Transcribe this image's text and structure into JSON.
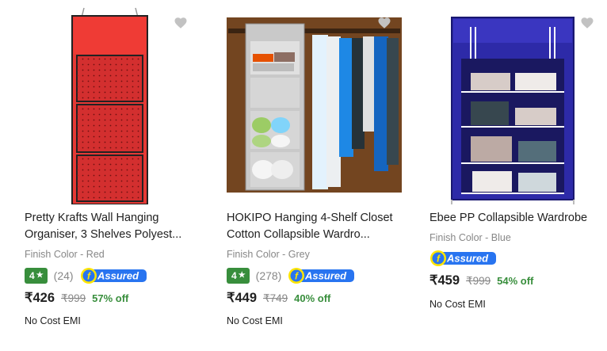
{
  "colors": {
    "accent_green": "#388e3c",
    "assured_blue": "#2874f0",
    "assured_yellow": "#ffe500",
    "muted": "#878787"
  },
  "products": [
    {
      "title_line1": "Pretty Krafts Wall Hanging",
      "title_line2": "Organiser, 3 Shelves Polyest...",
      "finish_color": "Finish Color - Red",
      "rating": "4",
      "rating_count": "(24)",
      "assured_label": "Assured",
      "price": "₹426",
      "mrp": "₹999",
      "discount": "57% off",
      "emi": "No Cost EMI",
      "wishlist_icon": "heart-icon"
    },
    {
      "title_line1": "HOKIPO Hanging 4-Shelf Closet",
      "title_line2": "Cotton Collapsible Wardro...",
      "finish_color": "Finish Color - Grey",
      "rating": "4",
      "rating_count": "(278)",
      "assured_label": "Assured",
      "price": "₹449",
      "mrp": "₹749",
      "discount": "40% off",
      "emi": "No Cost EMI",
      "wishlist_icon": "heart-icon"
    },
    {
      "title_line1": "Ebee PP Collapsible Wardrobe",
      "finish_color": "Finish Color - Blue",
      "assured_label": "Assured",
      "price": "₹459",
      "mrp": "₹999",
      "discount": "54% off",
      "emi": "No Cost EMI",
      "wishlist_icon": "heart-icon"
    }
  ]
}
